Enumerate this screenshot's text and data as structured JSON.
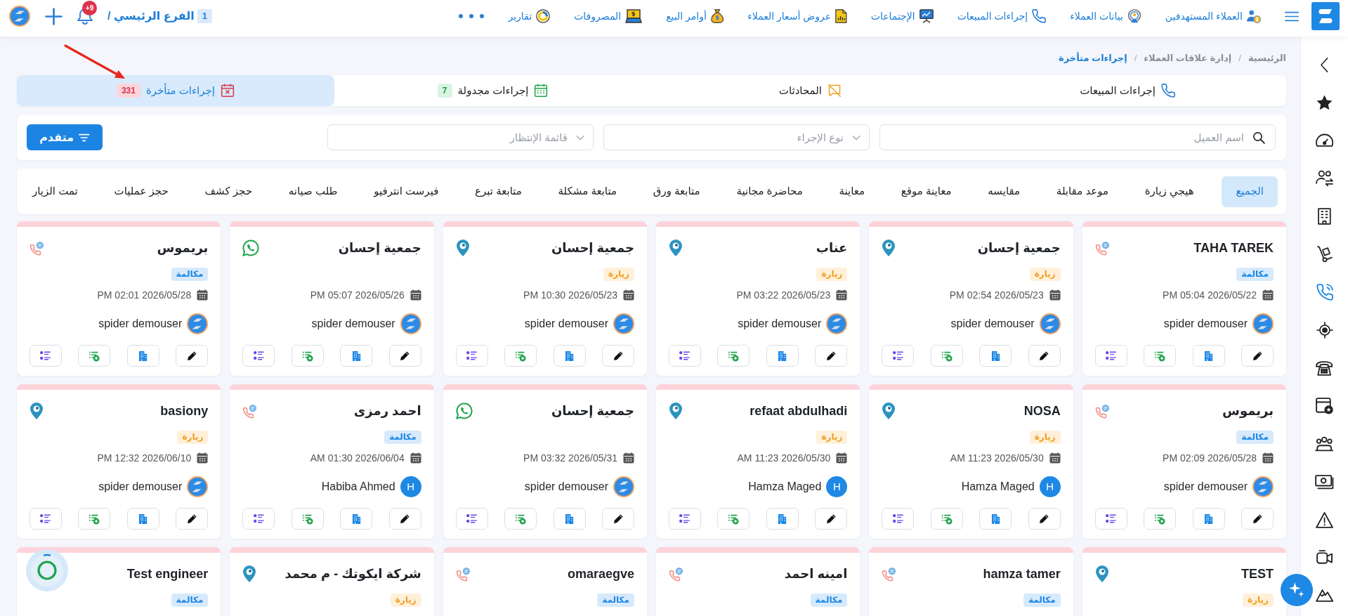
{
  "topbar": {
    "nav": [
      {
        "kind": "target-clients",
        "label": "العملاء المستهدفين"
      },
      {
        "kind": "client-data",
        "label": "بيانات العملاء"
      },
      {
        "kind": "sales-actions",
        "label": "إجراءات المبيعات"
      },
      {
        "kind": "meetings",
        "label": "الإجتماعات"
      },
      {
        "kind": "quotes",
        "label": "عروض أسعار العملاء"
      },
      {
        "kind": "sales-orders",
        "label": "أوامر البيع"
      },
      {
        "kind": "expenses",
        "label": "المصروفات"
      },
      {
        "kind": "reports",
        "label": "تقارير"
      }
    ],
    "branch": {
      "count": "1",
      "name": "الفرع الرئيسي /"
    },
    "notifications": "+9"
  },
  "sidebar": {
    "items": [
      {
        "kind": "collapse",
        "selected": false
      },
      {
        "kind": "star",
        "selected": false
      },
      {
        "kind": "gauge",
        "selected": false
      },
      {
        "kind": "users-swap",
        "selected": false
      },
      {
        "kind": "building",
        "selected": false
      },
      {
        "kind": "hand-truck",
        "selected": false
      },
      {
        "kind": "phone-waves",
        "selected": true
      },
      {
        "kind": "crosshair",
        "selected": false
      },
      {
        "kind": "telephone",
        "selected": false
      },
      {
        "kind": "calendar-star",
        "selected": false
      },
      {
        "kind": "people",
        "selected": false
      },
      {
        "kind": "money",
        "selected": false
      },
      {
        "kind": "warning",
        "selected": false
      },
      {
        "kind": "video",
        "selected": false
      },
      {
        "kind": "mountain",
        "selected": false
      }
    ]
  },
  "breadcrumb": [
    {
      "kind": "link",
      "label": "الرئيسية"
    },
    {
      "kind": "separator",
      "label": "/"
    },
    {
      "kind": "link",
      "label": "إدارة علاقات العملاء"
    },
    {
      "kind": "separator",
      "label": "/"
    },
    {
      "kind": "current",
      "label": "إجراءات متأخرة"
    }
  ],
  "tabs": [
    {
      "kind": "sales",
      "label": "إجراءات المبيعات",
      "selected": false
    },
    {
      "kind": "chats",
      "label": "المحادثات",
      "selected": false
    },
    {
      "kind": "scheduled",
      "label": "إجراءات مجدولة",
      "count": "7",
      "selected": false
    },
    {
      "kind": "overdue",
      "label": "إجراءات متأخرة",
      "count": "331",
      "selected": true
    }
  ],
  "filters": {
    "search": {
      "placeholder": "اسم العميل"
    },
    "selects": [
      {
        "placeholder": "نوع الإجراء"
      },
      {
        "placeholder": "قائمة الإنتظار"
      }
    ],
    "advanced_button": "متقدم"
  },
  "categories": [
    {
      "label": "الجميع",
      "selected": true
    },
    {
      "label": "هيجي زيارة",
      "selected": false
    },
    {
      "label": "موعد مقابلة",
      "selected": false
    },
    {
      "label": "مقايسه",
      "selected": false
    },
    {
      "label": "معاينة موقع",
      "selected": false
    },
    {
      "label": "معاينة",
      "selected": false
    },
    {
      "label": "محاضرة مجانية",
      "selected": false
    },
    {
      "label": "متابعة ورق",
      "selected": false
    },
    {
      "label": "متابعة مشكلة",
      "selected": false
    },
    {
      "label": "متابعة تبرع",
      "selected": false
    },
    {
      "label": "فيرست انترفيو",
      "selected": false
    },
    {
      "label": "طلب صيانه",
      "selected": false
    },
    {
      "label": "حجز كشف",
      "selected": false
    },
    {
      "label": "حجز عمليات",
      "selected": false
    },
    {
      "label": "تمت الزيار",
      "selected": false
    }
  ],
  "cards": [
    {
      "title": "TAHA TAREK",
      "kind": "call",
      "badge": {
        "kind": "call",
        "label": "مكالمة"
      },
      "date": "PM 05:04 2026/05/22",
      "user": {
        "name": "spider demouser",
        "avatar": {
          "kind": "logo"
        }
      },
      "actions": true
    },
    {
      "title": "جمعية إحسان",
      "kind": "visit",
      "badge": {
        "kind": "visit",
        "label": "زيارة"
      },
      "date": "PM 02:54 2026/05/23",
      "user": {
        "name": "spider demouser",
        "avatar": {
          "kind": "logo"
        }
      },
      "actions": true
    },
    {
      "title": "عناب",
      "kind": "visit",
      "badge": {
        "kind": "visit",
        "label": "زيارة"
      },
      "date": "PM 03:22 2026/05/23",
      "user": {
        "name": "spider demouser",
        "avatar": {
          "kind": "logo"
        }
      },
      "actions": true
    },
    {
      "title": "جمعية إحسان",
      "kind": "visit",
      "badge": {
        "kind": "visit",
        "label": "زيارة"
      },
      "date": "PM 10:30 2026/05/23",
      "user": {
        "name": "spider demouser",
        "avatar": {
          "kind": "logo"
        }
      },
      "actions": true
    },
    {
      "title": "جمعية إحسان",
      "kind": "whatsapp",
      "date": "PM 05:07 2026/05/26",
      "user": {
        "name": "spider demouser",
        "avatar": {
          "kind": "logo"
        }
      },
      "actions": true
    },
    {
      "title": "بريموس",
      "kind": "call",
      "badge": {
        "kind": "call",
        "label": "مكالمة"
      },
      "date": "PM 02:01 2026/05/28",
      "user": {
        "name": "spider demouser",
        "avatar": {
          "kind": "logo"
        }
      },
      "actions": true
    },
    {
      "title": "بريموس",
      "kind": "call",
      "badge": {
        "kind": "call",
        "label": "مكالمة"
      },
      "date": "PM 02:09 2026/05/28",
      "user": {
        "name": "spider demouser",
        "avatar": {
          "kind": "logo"
        }
      },
      "actions": true
    },
    {
      "title": "NOSA",
      "kind": "visit",
      "badge": {
        "kind": "visit",
        "label": "زيارة"
      },
      "date": "AM 11:23 2026/05/30",
      "user": {
        "name": "Hamza Maged",
        "avatar": {
          "kind": "initial",
          "letter": "H"
        }
      },
      "actions": true
    },
    {
      "title": "refaat abdulhadi",
      "kind": "visit",
      "badge": {
        "kind": "visit",
        "label": "زيارة"
      },
      "date": "AM 11:23 2026/05/30",
      "user": {
        "name": "Hamza Maged",
        "avatar": {
          "kind": "initial",
          "letter": "H"
        }
      },
      "actions": true
    },
    {
      "title": "جمعية إحسان",
      "kind": "whatsapp",
      "date": "PM 03:32 2026/05/31",
      "user": {
        "name": "spider demouser",
        "avatar": {
          "kind": "logo"
        }
      },
      "actions": true
    },
    {
      "title": "احمد رمزى",
      "kind": "call",
      "badge": {
        "kind": "call",
        "label": "مكالمة"
      },
      "date": "AM 01:30 2026/06/04",
      "user": {
        "name": "Habiba Ahmed",
        "avatar": {
          "kind": "initial",
          "letter": "H"
        }
      },
      "actions": true
    },
    {
      "title": "basiony",
      "kind": "visit",
      "badge": {
        "kind": "visit",
        "label": "زيارة"
      },
      "date": "PM 12:32 2026/06/10",
      "user": {
        "name": "spider demouser",
        "avatar": {
          "kind": "logo"
        }
      },
      "actions": true
    },
    {
      "title": "TEST",
      "kind": "visit",
      "badge": {
        "kind": "visit",
        "label": "زيارة"
      }
    },
    {
      "title": "hamza tamer",
      "kind": "call",
      "badge": {
        "kind": "call",
        "label": "مكالمة"
      }
    },
    {
      "title": "امينه احمد",
      "kind": "call",
      "badge": {
        "kind": "call",
        "label": "مكالمة"
      }
    },
    {
      "title": "omaraegve",
      "kind": "call",
      "badge": {
        "kind": "call",
        "label": "مكالمة"
      }
    },
    {
      "title": "شركة ايكوتك - م محمد",
      "kind": "visit",
      "badge": {
        "kind": "visit",
        "label": "زيارة"
      }
    },
    {
      "title": "Test engineer",
      "badge": {
        "kind": "call",
        "label": "مكالمة"
      }
    }
  ]
}
